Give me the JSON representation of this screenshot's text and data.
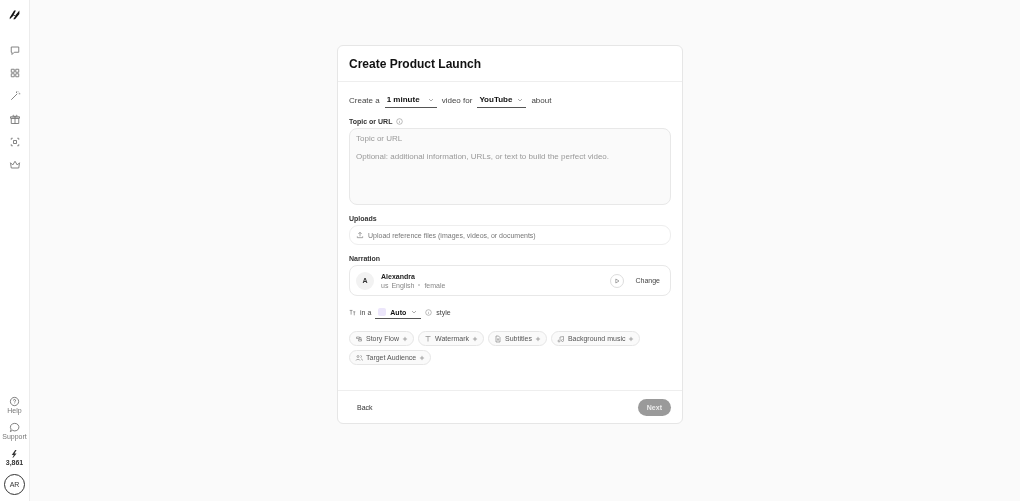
{
  "sidebar": {
    "nav": [
      {
        "kind": "chat"
      },
      {
        "kind": "grid"
      },
      {
        "kind": "wand"
      },
      {
        "kind": "gift"
      },
      {
        "kind": "scan"
      },
      {
        "kind": "crown"
      }
    ],
    "help": "Help",
    "support": "Support",
    "credits": "3,861",
    "avatar": "AR"
  },
  "dialog": {
    "title": "Create Product Launch",
    "sentence": {
      "prefix": "Create a",
      "duration": "1 minute",
      "middle": "video for",
      "platform": "YouTube",
      "suffix": "about"
    },
    "topic": {
      "label": "Topic or URL",
      "placeholder": "Topic or URL\n\nOptional: additional information, URLs, or text to build the perfect video."
    },
    "uploads": {
      "label": "Uploads",
      "placeholder": "Upload reference files (images, videos, or documents)"
    },
    "narration": {
      "label": "Narration",
      "initial": "A",
      "name": "Alexandra",
      "locale": "us",
      "language": "English",
      "gender": "female",
      "change": "Change"
    },
    "style": {
      "prefix": "in a",
      "value": "Auto",
      "suffix": "style"
    },
    "options": [
      {
        "kind": "flow",
        "label": "Story Flow"
      },
      {
        "kind": "text",
        "label": "Watermark"
      },
      {
        "kind": "doc",
        "label": "Subtitles"
      },
      {
        "kind": "music",
        "label": "Background music"
      },
      {
        "kind": "people",
        "label": "Target Audience"
      }
    ],
    "back": "Back",
    "next": {
      "label": "Next",
      "disabled": true
    }
  }
}
